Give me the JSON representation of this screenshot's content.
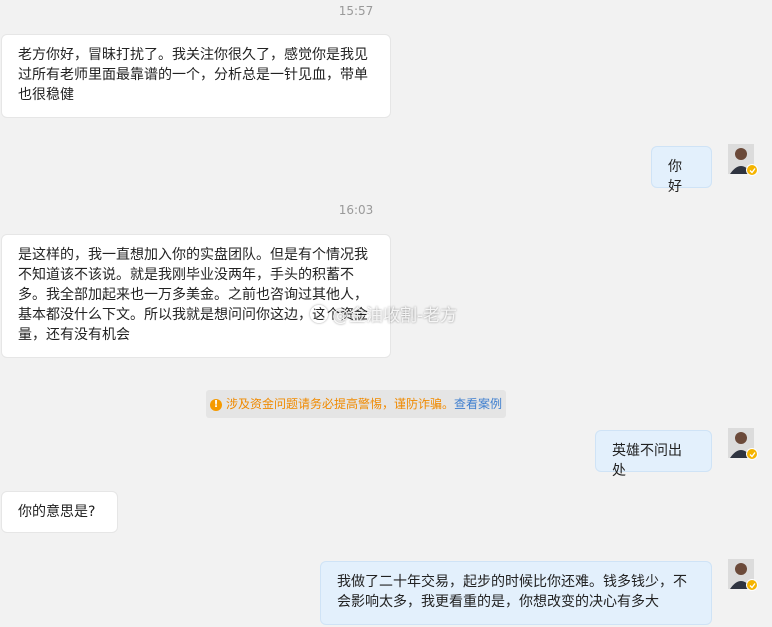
{
  "timestamps": [
    "15:57",
    "16:03"
  ],
  "messages": [
    {
      "from": "other",
      "text": "老方你好，冒昧打扰了。我关注你很久了，感觉你是我见\n过所有老师里面最靠谱的一个，分析总是一针见血，带单\n也很稳健"
    },
    {
      "from": "me",
      "text": "你好"
    },
    {
      "from": "other",
      "text": "是这样的，我一直想加入你的实盘团队。但是有个情况我\n不知道该不该说。就是我刚毕业没两年，手头的积蓄不\n多。我全部加起来也一万多美金。之前也咨询过其他人，\n基本都没什么下文。所以我就是想问问你这边，这个资金\n量，还有没有机会"
    },
    {
      "from": "me",
      "text": "英雄不问出处"
    },
    {
      "from": "other",
      "text": "你的意思是?"
    },
    {
      "from": "me",
      "text": "我做了二十年交易，起步的时候比你还难。钱多钱少，不\n会影响太多，我更看重的是，你想改变的决心有多大"
    }
  ],
  "notice": {
    "icon": "warning-icon",
    "text": "涉及资金问题请务必提高警惕，谨防诈骗。",
    "link": "查看案例"
  },
  "watermark": "@金油收割-老方",
  "colors": {
    "background": "#f2f2f2",
    "incoming_bubble": "#ffffff",
    "outgoing_bubble": "#e3f0fc",
    "notice_text": "#f08a00",
    "notice_link": "#3f7fcf",
    "badge": "#f5b400"
  }
}
